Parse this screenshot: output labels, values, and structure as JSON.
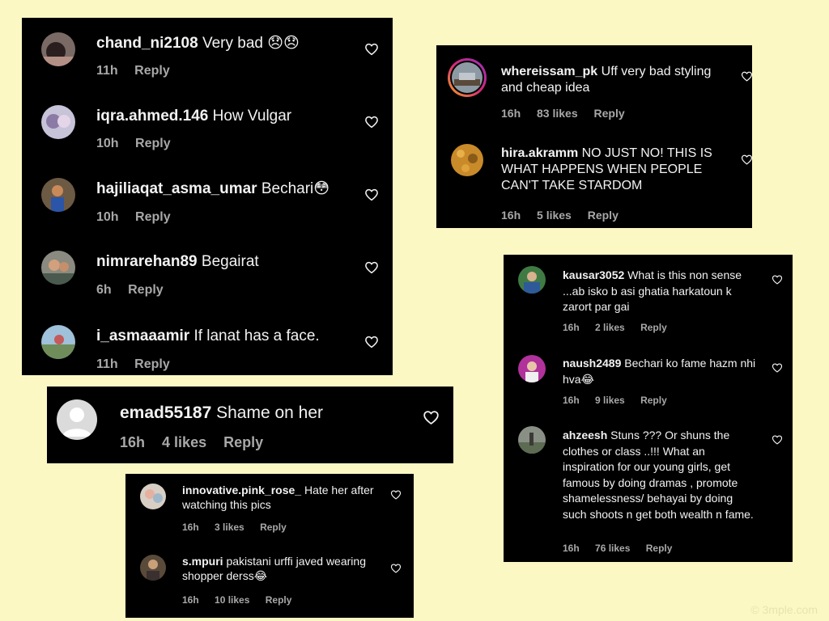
{
  "panels": {
    "p1": {
      "comments": [
        {
          "user": "chand_ni2108",
          "text": "Very bad",
          "emoji": "😞😞",
          "time": "11h",
          "reply": "Reply"
        },
        {
          "user": "iqra.ahmed.146",
          "text": "How Vulgar",
          "emoji": "",
          "time": "10h",
          "reply": "Reply"
        },
        {
          "user": "hajiliaqat_asma_umar",
          "text": "Bechari",
          "emoji": "😳",
          "time": "10h",
          "reply": "Reply"
        },
        {
          "user": "nimrarehan89",
          "text": "Begairat",
          "emoji": "",
          "time": "6h",
          "reply": "Reply"
        },
        {
          "user": "i_asmaaamir",
          "text": "If lanat has a face.",
          "emoji": "",
          "time": "11h",
          "reply": "Reply"
        }
      ]
    },
    "p2": {
      "comments": [
        {
          "user": "emad55187",
          "text": "Shame on her",
          "time": "16h",
          "likes": "4 likes",
          "reply": "Reply"
        }
      ]
    },
    "p3": {
      "comments": [
        {
          "user": "innovative.pink_rose_",
          "text": "Hate her after watching this pics",
          "time": "16h",
          "likes": "3 likes",
          "reply": "Reply"
        },
        {
          "user": "s.mpuri",
          "text": "pakistani urffi javed wearing shopper derss",
          "emoji": "😂",
          "time": "16h",
          "likes": "10 likes",
          "reply": "Reply"
        }
      ]
    },
    "p4": {
      "comments": [
        {
          "user": "whereissam_pk",
          "text": "Uff very bad styling and cheap idea",
          "time": "16h",
          "likes": "83 likes",
          "reply": "Reply"
        },
        {
          "user": "hira.akramm",
          "text": "NO JUST NO! THIS IS WHAT HAPPENS WHEN PEOPLE CAN'T TAKE STARDOM",
          "time": "16h",
          "likes": "5 likes",
          "reply": "Reply"
        }
      ]
    },
    "p5": {
      "comments": [
        {
          "user": "kausar3052",
          "text": "What is this non sense ...ab isko b asi ghatia harkatoun k zarort par gai",
          "time": "16h",
          "likes": "2 likes",
          "reply": "Reply"
        },
        {
          "user": "naush2489",
          "text": "Bechari ko fame hazm nhi hva",
          "emoji": "😂",
          "time": "16h",
          "likes": "9 likes",
          "reply": "Reply"
        },
        {
          "user": "ahzeesh",
          "text": "Stuns ??? Or shuns the clothes or class ..!!! What an inspiration for our young girls, get famous by doing dramas , promote shamelessness/ behayai by doing such shoots n get both wealth n fame.",
          "time": "16h",
          "likes": "76 likes",
          "reply": "Reply"
        }
      ]
    }
  },
  "watermark": "© 3mple.com",
  "colors": {
    "background": "#fbf8c4",
    "panel": "#000000",
    "meta": "#a8a8a8"
  }
}
